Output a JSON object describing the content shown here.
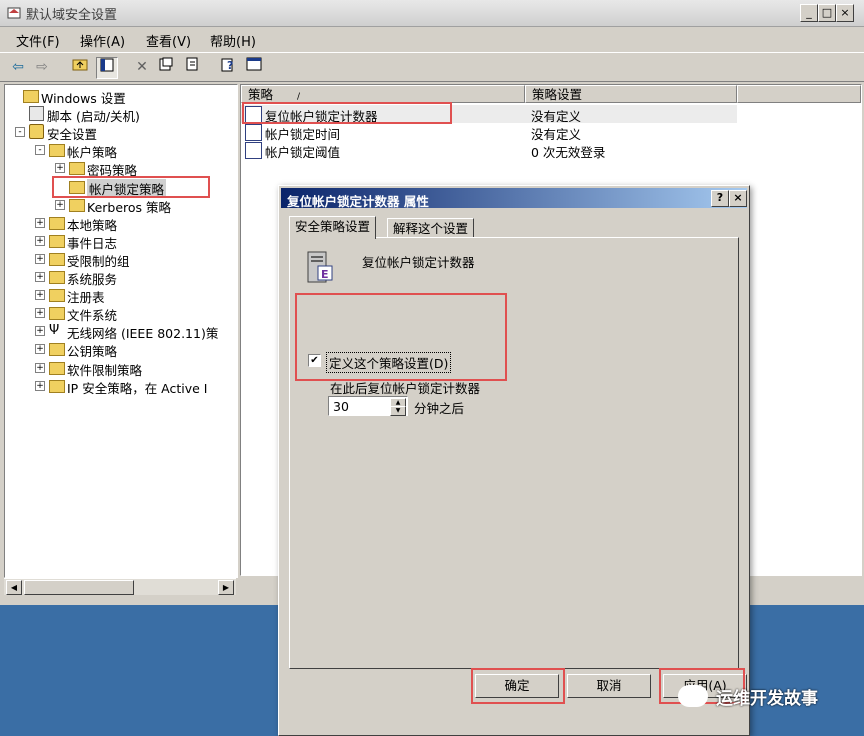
{
  "window": {
    "title": "默认域安全设置"
  },
  "menu": [
    "文件(F)",
    "操作(A)",
    "查看(V)",
    "帮助(H)"
  ],
  "tree": [
    {
      "label": "Windows 设置",
      "level": 0,
      "expander": "",
      "icon": "folder"
    },
    {
      "label": "脚本 (启动/关机)",
      "level": 1,
      "expander": "",
      "icon": "script"
    },
    {
      "label": "安全设置",
      "level": 1,
      "expander": "-",
      "icon": "security"
    },
    {
      "label": "帐户策略",
      "level": 2,
      "expander": "-",
      "icon": "folder"
    },
    {
      "label": "密码策略",
      "level": 3,
      "expander": "+",
      "icon": "folder"
    },
    {
      "label": "帐户锁定策略",
      "level": 3,
      "expander": "",
      "icon": "folder",
      "selected": true
    },
    {
      "label": "Kerberos 策略",
      "level": 3,
      "expander": "+",
      "icon": "folder"
    },
    {
      "label": "本地策略",
      "level": 2,
      "expander": "+",
      "icon": "folder"
    },
    {
      "label": "事件日志",
      "level": 2,
      "expander": "+",
      "icon": "folder"
    },
    {
      "label": "受限制的组",
      "level": 2,
      "expander": "+",
      "icon": "folder"
    },
    {
      "label": "系统服务",
      "level": 2,
      "expander": "+",
      "icon": "folder"
    },
    {
      "label": "注册表",
      "level": 2,
      "expander": "+",
      "icon": "folder"
    },
    {
      "label": "文件系统",
      "level": 2,
      "expander": "+",
      "icon": "folder"
    },
    {
      "label": "无线网络 (IEEE 802.11)策",
      "level": 2,
      "expander": "+",
      "icon": "antenna"
    },
    {
      "label": "公钥策略",
      "level": 2,
      "expander": "+",
      "icon": "folder"
    },
    {
      "label": "软件限制策略",
      "level": 2,
      "expander": "+",
      "icon": "folder"
    },
    {
      "label": "IP 安全策略，在 Active I",
      "level": 2,
      "expander": "+",
      "icon": "folder"
    }
  ],
  "list": {
    "headers": [
      "策略",
      "策略设置"
    ],
    "rows": [
      {
        "name": "复位帐户锁定计数器",
        "value": "没有定义"
      },
      {
        "name": "帐户锁定时间",
        "value": "没有定义"
      },
      {
        "name": "帐户锁定阈值",
        "value": "0 次无效登录"
      }
    ]
  },
  "dialog": {
    "title": "复位帐户锁定计数器 属性",
    "help_btn": "?",
    "close_btn": "×",
    "tabs": [
      "安全策略设置",
      "解释这个设置"
    ],
    "policy_name": "复位帐户锁定计数器",
    "checkbox_label": "定义这个策略设置(D)",
    "checked": true,
    "field_label": "在此后复位帐户锁定计数器",
    "field_value": "30",
    "field_unit": "分钟之后",
    "buttons": [
      "确定",
      "取消",
      "应用(A)"
    ]
  },
  "watermark": "运维开发故事",
  "colors": {
    "highlight": "#e05050",
    "titlebar": "#0a246a",
    "desktop": "#3a6ea5"
  }
}
